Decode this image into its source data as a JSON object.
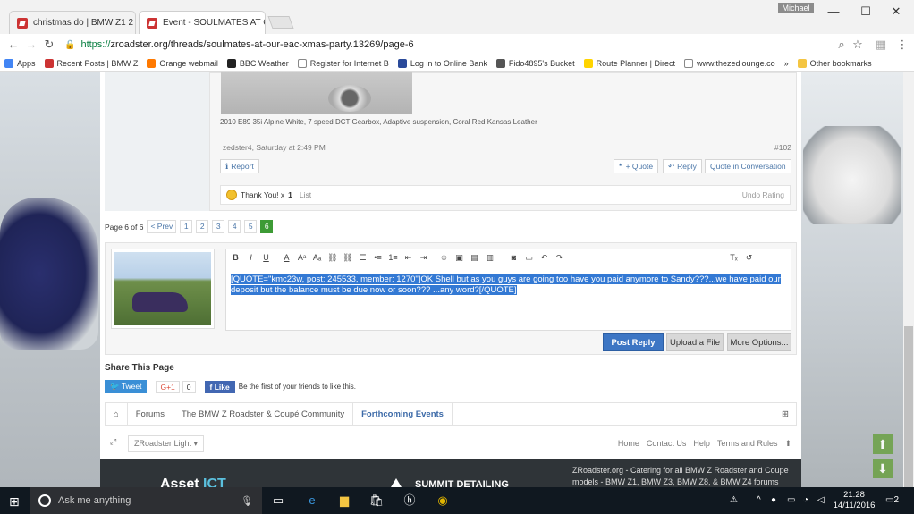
{
  "window": {
    "user": "Michael",
    "tabs": [
      {
        "title": "christmas do | BMW Z1 2"
      },
      {
        "title": "Event - SOULMATES AT C"
      }
    ]
  },
  "address": {
    "scheme": "https://",
    "rest": "zroadster.org/threads/soulmates-at-our-eac-xmas-party.13269/page-6"
  },
  "bookmarks": [
    {
      "label": "Apps",
      "color": "#4285f4"
    },
    {
      "label": "Recent Posts | BMW Z",
      "color": "#c33"
    },
    {
      "label": "Orange webmail",
      "color": "#ff7900"
    },
    {
      "label": "BBC Weather",
      "color": "#222"
    },
    {
      "label": "Register for Internet B",
      "color": "#888"
    },
    {
      "label": "Log in to Online Bank",
      "color": "#2a4a9a"
    },
    {
      "label": "Fido4895's Bucket",
      "color": "#555"
    },
    {
      "label": "Route Planner | Direct",
      "color": "#ffd400"
    },
    {
      "label": "www.thezedlounge.co",
      "color": "#888"
    },
    {
      "label": "»",
      "color": "#fff"
    },
    {
      "label": "Other bookmarks",
      "color": "#f4c542"
    }
  ],
  "post": {
    "signature": "2010 E89 35i Alpine White, 7 speed DCT Gearbox, Adaptive suspension, Coral Red Kansas Leather",
    "author_time": "zedster4, Saturday at 2:49 PM",
    "number": "#102",
    "report": "Report",
    "quote": "+ Quote",
    "reply": "Reply",
    "quote_conv": "Quote in Conversation",
    "likes_text": "Thank You! x",
    "likes_count": "1",
    "list_link": "List",
    "undo": "Undo Rating"
  },
  "pagination": {
    "label": "Page 6 of 6",
    "prev": "< Prev",
    "pages": [
      "1",
      "2",
      "3",
      "4",
      "5",
      "6"
    ]
  },
  "editor": {
    "text": "[QUOTE=\"kmc23w, post: 245533, member: 1270\"]OK Shell but as you guys are going too have you paid anymore to Sandy???...we have paid our deposit but the balance must be due now or soon??? ...any word?[/QUOTE]",
    "post_reply": "Post Reply",
    "upload": "Upload a File",
    "more": "More Options..."
  },
  "share": {
    "title": "Share This Page",
    "tweet": "Tweet",
    "gplus": "G+1",
    "gplus_count": "0",
    "like": "Like",
    "fb_text": "Be the first of your friends to like this."
  },
  "breadcrumb": [
    "Forums",
    "The BMW Z Roadster & Coupé Community",
    "Forthcoming Events"
  ],
  "footer": {
    "style": "ZRoadster Light",
    "links": [
      "Home",
      "Contact Us",
      "Help",
      "Terms and Rules"
    ],
    "site_text": "ZRoadster.org - Catering for all BMW Z Roadster and Coupe models - BMW Z1, BMW Z3, BMW Z8, & BMW Z4 forums",
    "asset_logo_a": "Asset",
    "asset_logo_b": "ICT",
    "summit": "SUMMIT DETAILING"
  },
  "taskbar": {
    "search": "Ask me anything",
    "time": "21:28",
    "date": "14/11/2016",
    "notif": "2"
  }
}
